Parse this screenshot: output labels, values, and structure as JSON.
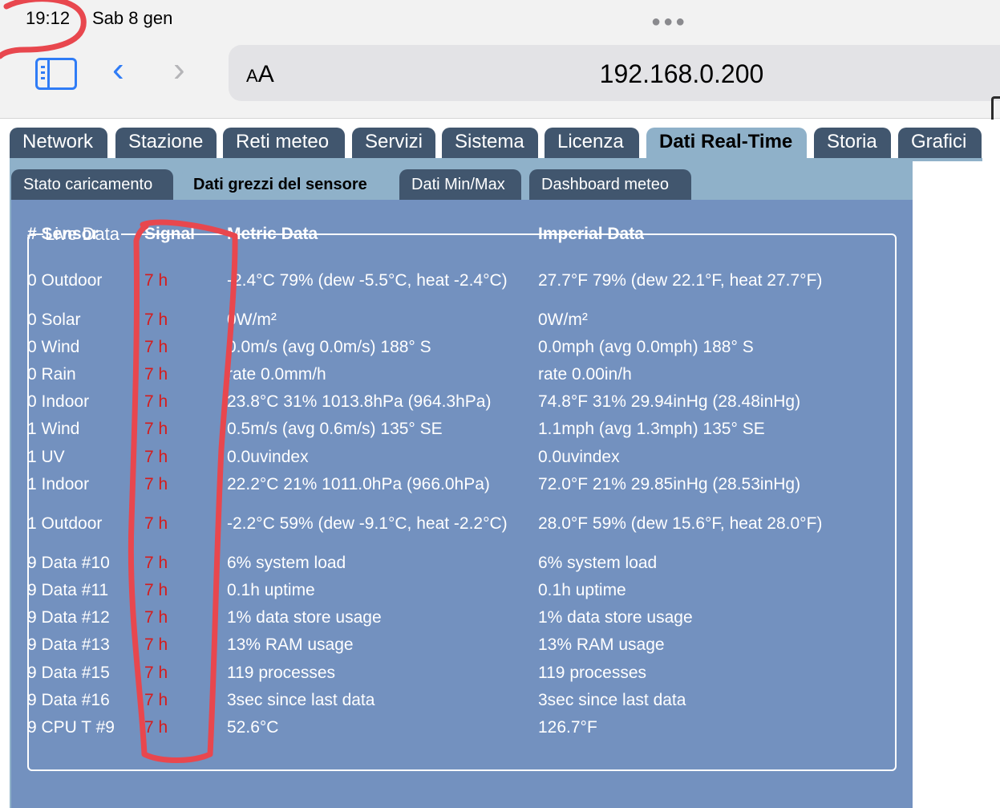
{
  "status": {
    "time": "19:12",
    "date": "Sab 8 gen"
  },
  "browser": {
    "aa_small": "A",
    "aa_large": "A",
    "url": "192.168.0.200"
  },
  "main_tabs": [
    {
      "label": "Network"
    },
    {
      "label": "Stazione"
    },
    {
      "label": "Reti meteo"
    },
    {
      "label": "Servizi"
    },
    {
      "label": "Sistema"
    },
    {
      "label": "Licenza"
    },
    {
      "label": "Dati Real-Time",
      "active": true
    },
    {
      "label": "Storia"
    },
    {
      "label": "Grafici"
    }
  ],
  "sub_tabs": [
    {
      "label": "Stato caricamento"
    },
    {
      "label": "Dati grezzi del sensore",
      "active": true
    },
    {
      "label": "Dati Min/Max"
    },
    {
      "label": "Dashboard meteo"
    }
  ],
  "live_data": {
    "legend": "Live Data",
    "headers": {
      "sensor": "# Sensor",
      "signal": "Signal",
      "metric": "Metric Data",
      "imperial": "Imperial Data"
    },
    "rows": [
      {
        "sensor": "0 Outdoor",
        "signal": "7 h",
        "metric": "-2.4°C 79% (dew -5.5°C, heat -2.4°C)",
        "imperial": "27.7°F 79% (dew 22.1°F, heat 27.7°F)"
      },
      {
        "sensor": "0 Solar",
        "signal": "7 h",
        "metric": "0W/m²",
        "imperial": "0W/m²"
      },
      {
        "sensor": "0 Wind",
        "signal": "7 h",
        "metric": "0.0m/s (avg 0.0m/s) 188° S",
        "imperial": "0.0mph (avg 0.0mph) 188° S"
      },
      {
        "sensor": "0 Rain",
        "signal": "7 h",
        "metric": "rate 0.0mm/h",
        "imperial": "rate 0.00in/h"
      },
      {
        "sensor": "0 Indoor",
        "signal": "7 h",
        "metric": "23.8°C 31% 1013.8hPa (964.3hPa)",
        "imperial": "74.8°F 31% 29.94inHg (28.48inHg)"
      },
      {
        "sensor": "1 Wind",
        "signal": "7 h",
        "metric": "0.5m/s (avg 0.6m/s) 135° SE",
        "imperial": "1.1mph (avg 1.3mph) 135° SE"
      },
      {
        "sensor": "1 UV",
        "signal": "7 h",
        "metric": "0.0uvindex",
        "imperial": "0.0uvindex"
      },
      {
        "sensor": "1 Indoor",
        "signal": "7 h",
        "metric": "22.2°C 21% 1011.0hPa (966.0hPa)",
        "imperial": "72.0°F 21% 29.85inHg (28.53inHg)"
      },
      {
        "sensor": "1 Outdoor",
        "signal": "7 h",
        "metric": "-2.2°C 59% (dew -9.1°C, heat -2.2°C)",
        "imperial": "28.0°F 59% (dew 15.6°F, heat 28.0°F)"
      },
      {
        "sensor": "9 Data #10",
        "signal": "7 h",
        "metric": "6% system load",
        "imperial": "6% system load"
      },
      {
        "sensor": "9 Data #11",
        "signal": "7 h",
        "metric": "0.1h uptime",
        "imperial": "0.1h uptime"
      },
      {
        "sensor": "9 Data #12",
        "signal": "7 h",
        "metric": "1% data store usage",
        "imperial": "1% data store usage"
      },
      {
        "sensor": "9 Data #13",
        "signal": "7 h",
        "metric": "13% RAM usage",
        "imperial": "13% RAM usage"
      },
      {
        "sensor": "9 Data #15",
        "signal": "7 h",
        "metric": "119 processes",
        "imperial": "119 processes"
      },
      {
        "sensor": "9 Data #16",
        "signal": "7 h",
        "metric": "3sec since last data",
        "imperial": "3sec since last data"
      },
      {
        "sensor": "9 CPU T #9",
        "signal": "7 h",
        "metric": "52.6°C",
        "imperial": "126.7°F"
      }
    ]
  },
  "colors": {
    "tab_dark": "#41566e",
    "tab_active": "#8fb1c9",
    "panel_blue": "#7391bf",
    "signal_red": "#d51c1c",
    "annotation_red": "#e8474e",
    "safari_blue": "#2f7cf6"
  }
}
